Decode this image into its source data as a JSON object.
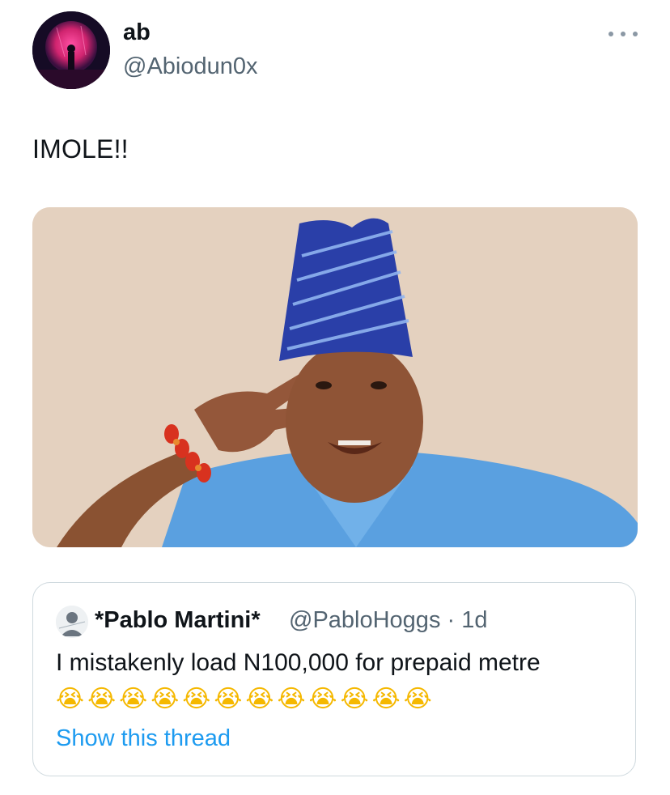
{
  "author": {
    "display_name": "ab",
    "handle": "@Abiodun0x"
  },
  "tweet": {
    "text": "IMOLE!!"
  },
  "icons": {
    "more": "more-horizontal-icon"
  },
  "quoted_tweet": {
    "display_name": "*Pablo Martini*",
    "handle_and_time": "@PabloHoggs · 1d",
    "text": "I mistakenly load N100,000 for prepaid metre",
    "emojis": [
      "😭",
      "😭",
      "😭",
      "😭",
      "😭",
      "😭",
      "😭",
      "😭",
      "😭",
      "😭",
      "😭",
      "😭"
    ],
    "show_thread_label": "Show this thread"
  },
  "colors": {
    "link": "#1d9bf0",
    "secondary_text": "#536471",
    "border": "#cfd9de"
  }
}
